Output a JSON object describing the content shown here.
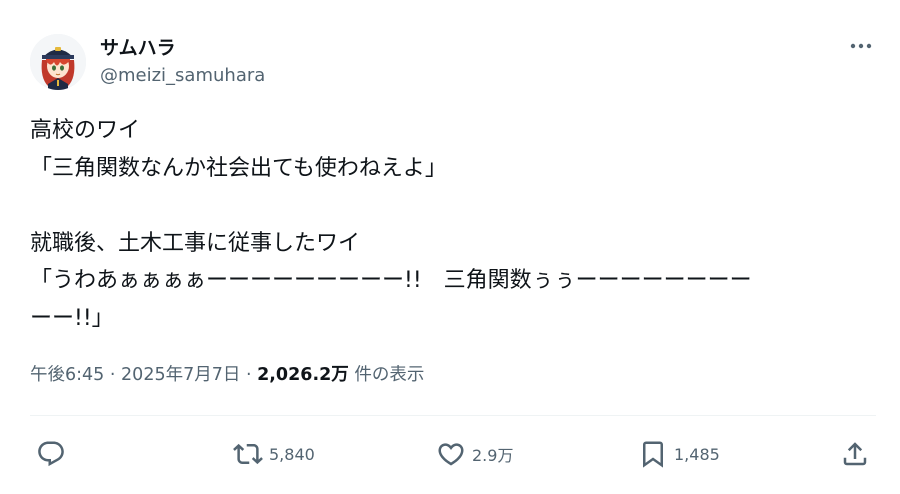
{
  "author": {
    "display_name": "サムハラ",
    "handle": "@meizi_samuhara"
  },
  "tweet": {
    "lines": [
      "高校のワイ",
      "「三角関数なんか社会出ても使わねえよ」",
      "",
      "就職後、土木工事に従事したワイ",
      "「うわあぁぁぁぁーーーーーーーーー!!　三角関数ぅぅーーーーーーーー",
      "ーー!!」"
    ]
  },
  "meta": {
    "time": "午後6:45",
    "separator": "·",
    "date": "2025年7月7日",
    "views_count": "2,026.2万",
    "views_label": "件の表示"
  },
  "actions": {
    "reply": {
      "icon": "reply-icon",
      "count": ""
    },
    "retweet": {
      "icon": "retweet-icon",
      "count": "5,840"
    },
    "like": {
      "icon": "heart-icon",
      "count": "2.9万"
    },
    "bookmark": {
      "icon": "bookmark-icon",
      "count": "1,485"
    },
    "share": {
      "icon": "share-icon",
      "count": ""
    }
  },
  "colors": {
    "text_primary": "#0f1419",
    "text_secondary": "#536471",
    "divider": "#eff3f4"
  }
}
